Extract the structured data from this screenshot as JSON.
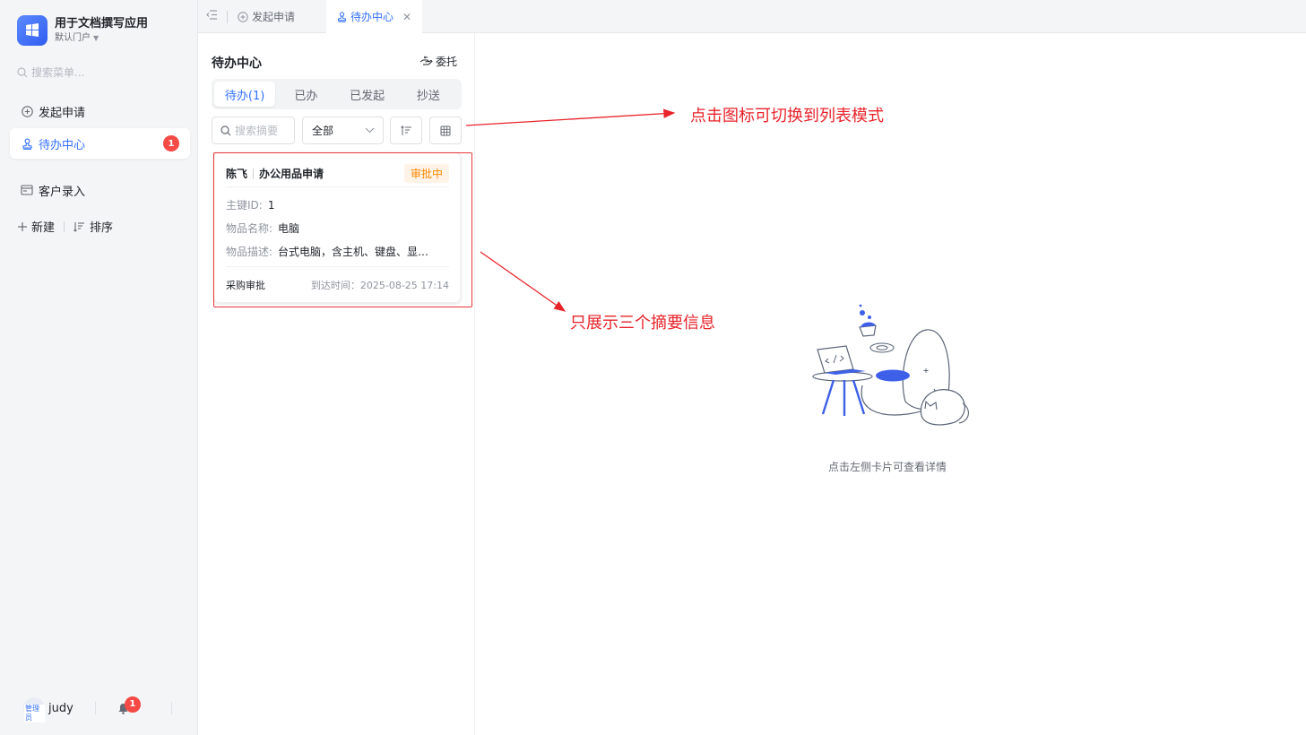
{
  "app": {
    "title": "用于文档撰写应用",
    "portal": "默认门户"
  },
  "sidebar": {
    "search_placeholder": "搜索菜单...",
    "items": [
      {
        "label": "发起申请",
        "icon": "plus-circle-icon",
        "active": false
      },
      {
        "label": "待办中心",
        "icon": "stamp-icon",
        "active": true,
        "badge": "1"
      },
      {
        "label": "客户录入",
        "icon": "form-icon",
        "active": false
      }
    ],
    "tools": {
      "new_label": "新建",
      "sort_label": "排序"
    },
    "footer": {
      "user": "judy",
      "role": "管理员",
      "notify_count": "1"
    }
  },
  "tabs": [
    {
      "label": "发起申请",
      "icon": "plus-circle-icon",
      "active": false
    },
    {
      "label": "待办中心",
      "icon": "stamp-icon",
      "active": true,
      "closable": true
    }
  ],
  "panel": {
    "title": "待办中心",
    "delegate_label": "委托",
    "segments": [
      {
        "label": "待办(1)",
        "active": true
      },
      {
        "label": "已办",
        "active": false
      },
      {
        "label": "已发起",
        "active": false
      },
      {
        "label": "抄送",
        "active": false
      }
    ],
    "search_placeholder": "搜索摘要",
    "filter_value": "全部",
    "card": {
      "user": "陈飞",
      "title": "办公用品申请",
      "status": "审批中",
      "status_color": "#ff8800",
      "fields": [
        {
          "label": "主键ID:",
          "value": "1"
        },
        {
          "label": "物品名称:",
          "value": "电脑"
        },
        {
          "label": "物品描述:",
          "value": "台式电脑，含主机、键盘、显…"
        }
      ],
      "node": "采购审批",
      "arrival": "到达时间：2025-08-25 17:14"
    }
  },
  "annotations": {
    "switch_hint": "点击图标可切换到列表模式",
    "summary_hint": "只展示三个摘要信息"
  },
  "empty_state": {
    "text": "点击左侧卡片可查看详情"
  },
  "colors": {
    "primary": "#3370ff",
    "badge": "#f54a45",
    "annotation": "#e8232a",
    "status_bg": "#fff3e8"
  }
}
